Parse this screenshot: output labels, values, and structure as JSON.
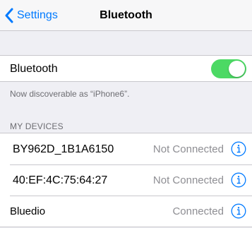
{
  "navbar": {
    "back_label": "Settings",
    "title": "Bluetooth"
  },
  "bluetooth": {
    "label": "Bluetooth",
    "enabled": true,
    "discoverable_note": "Now discoverable as “iPhone6”."
  },
  "devices_section": {
    "header": "MY DEVICES",
    "items": [
      {
        "name": "BY962D_1B1A6150",
        "status": "Not Connected",
        "icon": "info-icon"
      },
      {
        "name": "40:EF:4C:75:64:27",
        "status": "Not Connected",
        "icon": "info-icon"
      },
      {
        "name": "Bluedio",
        "status": "Connected",
        "icon": "info-icon"
      }
    ]
  },
  "colors": {
    "accent": "#007aff",
    "toggle_on": "#4cd964",
    "background": "#efeff4"
  }
}
